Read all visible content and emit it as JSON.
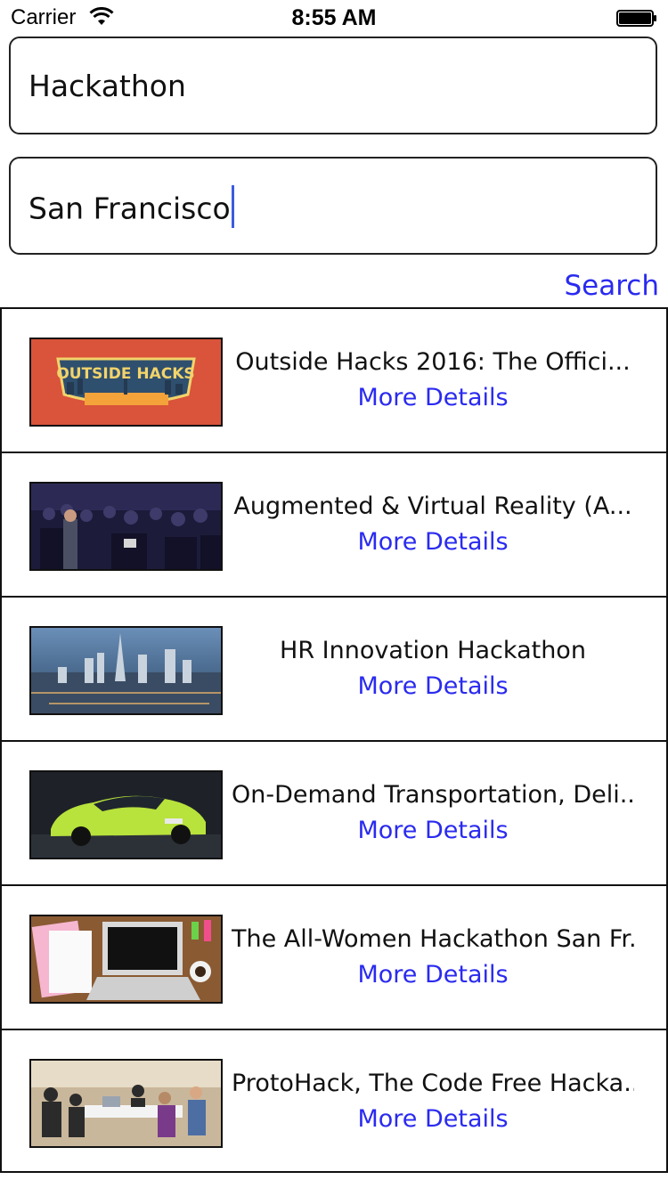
{
  "status_bar": {
    "carrier": "Carrier",
    "time": "8:55 AM"
  },
  "form": {
    "keyword_value": "Hackathon",
    "location_value": "San Francisco",
    "search_label": "Search"
  },
  "events": [
    {
      "title": "Outside Hacks 2016: The Offici...",
      "details_label": "More Details",
      "image_text": "OUTSIDE HACKS"
    },
    {
      "title": "Augmented & Virtual Reality (A...",
      "details_label": "More Details"
    },
    {
      "title": "HR Innovation Hackathon",
      "details_label": "More Details"
    },
    {
      "title": "On-Demand Transportation, Deli...",
      "details_label": "More Details"
    },
    {
      "title": "The All-Women Hackathon San Fr...",
      "details_label": "More Details"
    },
    {
      "title": "ProtoHack, The Code Free Hacka...",
      "details_label": "More Details"
    }
  ],
  "colors": {
    "link": "#2a2af0",
    "caret": "#3b5de0"
  }
}
